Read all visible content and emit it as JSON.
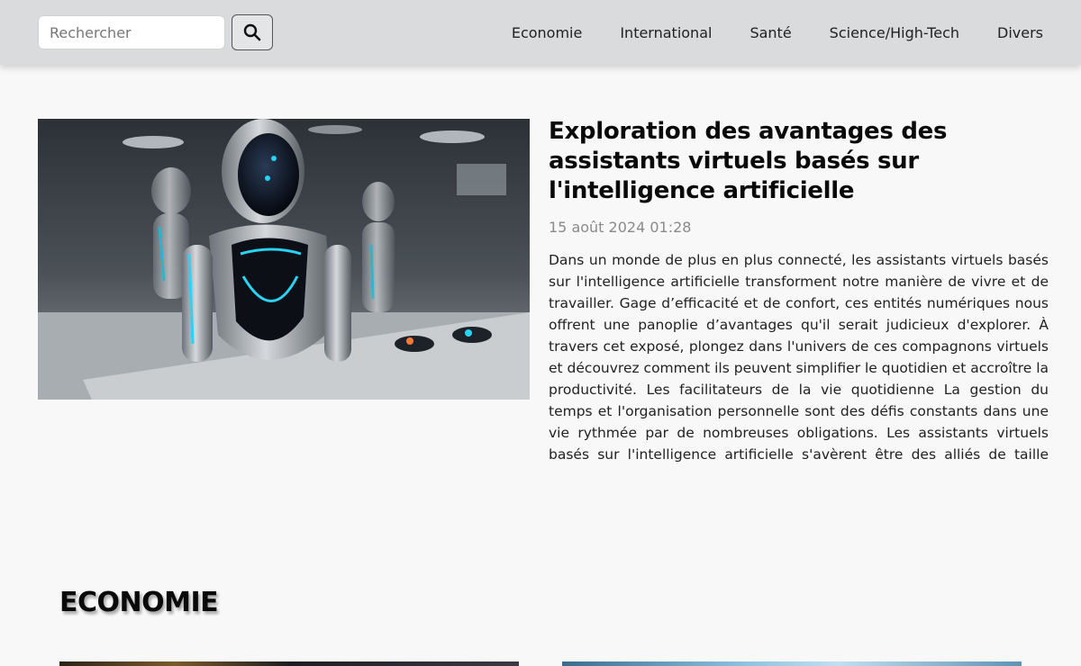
{
  "header": {
    "search": {
      "placeholder": "Rechercher",
      "value": ""
    },
    "search_button_icon": "search-icon",
    "nav": [
      {
        "label": "Economie"
      },
      {
        "label": "International"
      },
      {
        "label": "Santé"
      },
      {
        "label": "Science/High-Tech"
      },
      {
        "label": "Divers"
      }
    ]
  },
  "featured": {
    "image_alt_icon": "robot-photo",
    "title": "Exploration des avantages des assistants virtuels basés sur l'intelligence artificielle",
    "date": "15 août 2024 01:28",
    "excerpt": "Dans un monde de plus en plus connecté, les assistants virtuels basés sur l'intelligence artificielle transforment notre manière de vivre et de travailler. Gage d’efficacité et de confort, ces entités numériques nous offrent une panoplie d’avantages qu'il serait judicieux d'explorer. À travers cet exposé, plongez dans l'univers de ces compagnons virtuels et découvrez comment ils peuvent simplifier le quotidien et accroître la productivité. Les facilitateurs de la vie quotidienne La gestion du temps et l'organisation personnelle sont des défis constants dans une vie rythmée par de nombreuses obligations. Les assistants virtuels basés sur l'intelligence artificielle s'avèrent être des alliés de taille dans ..."
  },
  "section": {
    "title": "ECONOMIE"
  },
  "colors": {
    "topbar": "#d9dbdc",
    "background": "#f8f8f8",
    "accent_cyan": "#29d3f5",
    "date_gray": "#8a8a8a"
  }
}
